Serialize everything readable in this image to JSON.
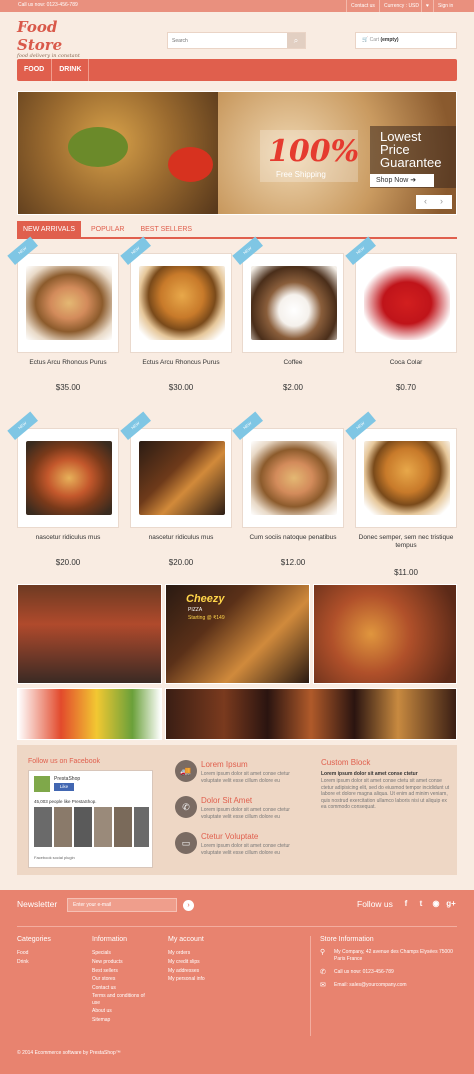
{
  "topbar": {
    "call": "Call us now: 0123-456-789",
    "contact": "Contact us",
    "currency": "Currency : USD",
    "heart": "♥",
    "signin": "Sign in"
  },
  "header": {
    "logo_title": "Food Store",
    "logo_tagline": "food delivery in constant",
    "search_placeholder": "Search",
    "cart_label": "Cart",
    "cart_status": "(empty)"
  },
  "nav": {
    "items": [
      "FOOD",
      "DRINK"
    ]
  },
  "hero": {
    "percent": "100%",
    "free_shipping": "Free Shipping",
    "line1": "Lowest",
    "line2": "Price",
    "line3": "Guarantee",
    "shop_now": "Shop Now"
  },
  "tabs": [
    "NEW ARRIVALS",
    "POPULAR",
    "BEST SELLERS"
  ],
  "ribbon": "NEW",
  "products": [
    {
      "name": "Ectus Arcu Rhoncus Purus",
      "price": "$35.00",
      "img": "sandwich"
    },
    {
      "name": "Ectus Arcu Rhoncus Purus",
      "price": "$30.00",
      "img": "burger"
    },
    {
      "name": "Coffee",
      "price": "$2.00",
      "img": "coffee"
    },
    {
      "name": "Coca Colar",
      "price": "$0.70",
      "img": "coke"
    },
    {
      "name": "nascetur ridiculus mus",
      "price": "$20.00",
      "img": "pizza"
    },
    {
      "name": "nascetur ridiculus mus",
      "price": "$20.00",
      "img": "pizza-ad"
    },
    {
      "name": "Cum sociis natoque penatibus",
      "price": "$12.00",
      "img": "sandwich"
    },
    {
      "name": "Donec semper, sem nec tristique tempus",
      "price": "$11.00",
      "img": "burger"
    }
  ],
  "banner_pizza": {
    "brand": "Cheezy",
    "subtitle": "PIZZA",
    "price": "Starting @ ₹149"
  },
  "facebook": {
    "title": "Follow us on Facebook",
    "page": "PrestaShop",
    "like": "Like",
    "count": "45,003 people like PrestaShop.",
    "plugin": "Facebook social plugin"
  },
  "services": [
    {
      "title": "Lorem Ipsum",
      "text": "Lorem ipsum dolor sit amet conse ctetur voluptate velit esse cillum dolore eu",
      "icon": "truck-icon",
      "glyph": "🚚"
    },
    {
      "title": "Dolor Sit Amet",
      "text": "Lorem ipsum dolor sit amet conse ctetur voluptate velit esse cillum dolore eu",
      "icon": "phone-icon",
      "glyph": "✆"
    },
    {
      "title": "Ctetur Voluptate",
      "text": "Lorem ipsum dolor sit amet conse ctetur voluptate velit esse cillum dolore eu",
      "icon": "card-icon",
      "glyph": "▭"
    }
  ],
  "custom_block": {
    "title": "Custom Block",
    "bold": "Lorem ipsum dolor sit amet conse ctetur",
    "text": "Lorem ipsum dolor sit amet conse ctetu sit amet conse ctetur adipisicing elit, sed do eiusmod tempor incididunt ut labore et dolore magna aliqua. Ut enim ad minim veniam, quis nostrud exercitation ullamco laboris nisi ut aliquip ex ea commodo consequat."
  },
  "footer": {
    "newsletter": "Newsletter",
    "newsletter_placeholder": "Enter your e-mail",
    "follow": "Follow us",
    "social": [
      "f",
      "t",
      "◉",
      "g+"
    ],
    "categories": {
      "title": "Categories",
      "items": [
        "Food",
        "Drink"
      ]
    },
    "information": {
      "title": "Information",
      "items": [
        "Specials",
        "New products",
        "Best sellers",
        "Our stores",
        "Contact us",
        "Terms and conditions of use",
        "About us",
        "Sitemap"
      ]
    },
    "account": {
      "title": "My account",
      "items": [
        "My orders",
        "My credit slips",
        "My addresses",
        "My personal info"
      ]
    },
    "store": {
      "title": "Store Information",
      "address": "My Company, 42 avenue des Champs Elysées 75000 Paris France",
      "call_label": "Call us now:",
      "phone": "0123-456-789",
      "email_label": "Email:",
      "email": "sales@yourcompany.com"
    },
    "copyright": "© 2014 Ecommerce software by PrestaShop™"
  }
}
